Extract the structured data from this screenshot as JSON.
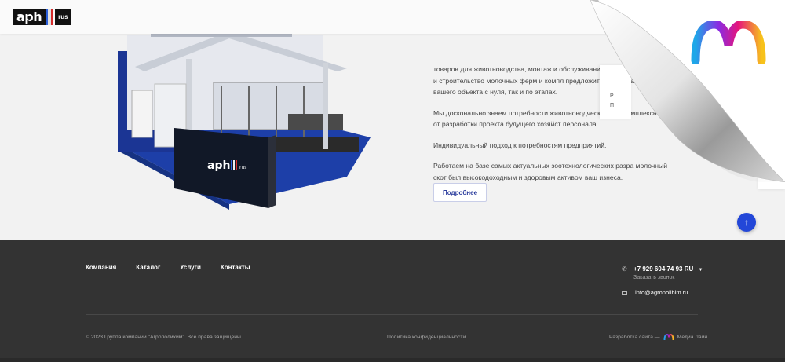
{
  "header": {
    "logo_main": "aph",
    "logo_sub": "rus"
  },
  "booth": {
    "sign_main": "aph",
    "sign_sub": "rus"
  },
  "main": {
    "paragraphs": [
      "товаров для животноводства, монтаж и обслуживание об проектирование и строительство молочных ферм и компл предложить как создание вашего объекта с нуля, так и по этапах.",
      "Мы досконально знаем потребности животноводческого его комплексно: от разработки проекта будущего хозяйст персонала.",
      "Индивидуальный подход к потребностям предприятий.",
      "Работаем на базе самых актуальных зоотехнологических разра молочный скот был высокодоходным и здоровым активом ваш изнеса."
    ],
    "more_button": "Подробнее",
    "side_card": [
      "Р",
      "П"
    ],
    "scroll_up": "↑"
  },
  "footer": {
    "nav": [
      "Компания",
      "Каталог",
      "Услуги",
      "Контакты"
    ],
    "phone": "+7 929 604 74 93 RU",
    "callback": "Заказать звонок",
    "email": "info@agropolihim.ru",
    "copyright": "© 2023 Группа компаний \"Агрополихим\". Все права защищены.",
    "policy": "Политика конфиденциальности",
    "developer_prefix": "Разработка сайта —",
    "developer_name": "Медиа Лайн"
  },
  "colors": {
    "accent_blue": "#2347d8",
    "footer_bg": "#333333",
    "logo_bars": [
      "#2b5fd9",
      "#e0e0e0",
      "#d62b2b"
    ]
  },
  "icons": {
    "phone": "phone-icon",
    "email": "envelope-icon",
    "scroll_up": "arrow-up-icon"
  }
}
